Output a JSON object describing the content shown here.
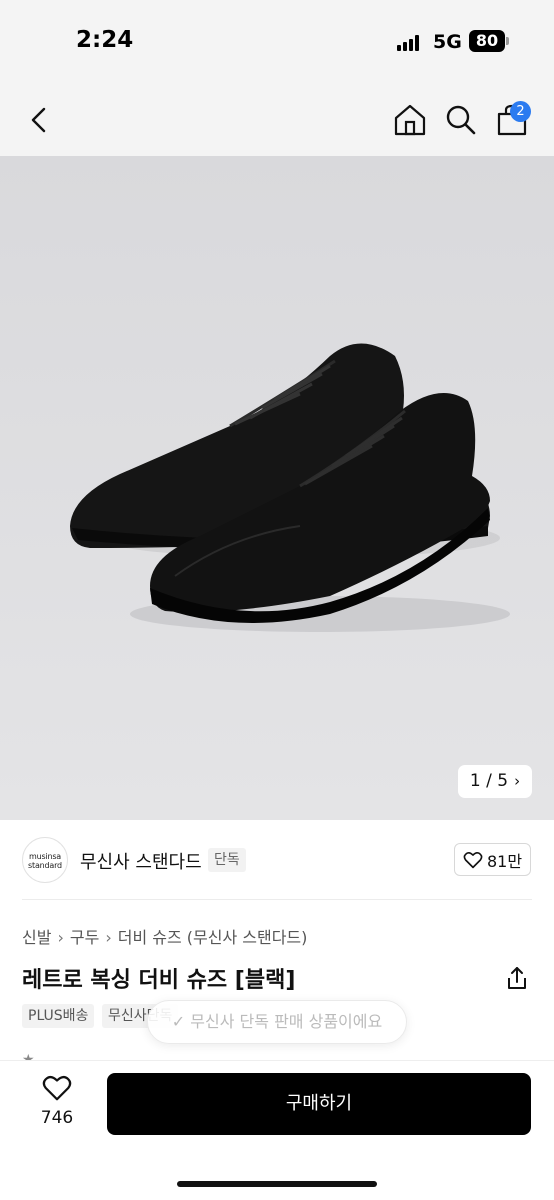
{
  "status": {
    "time": "2:24",
    "network": "5G",
    "battery": "80"
  },
  "nav": {
    "back_icon": "chevron-left-icon",
    "home_icon": "home-icon",
    "search_icon": "search-icon",
    "cart_icon": "shopping-bag-icon",
    "cart_badge": "2"
  },
  "gallery": {
    "current": "1",
    "total": "5",
    "indicator": "1 / 5"
  },
  "brand": {
    "logo_line1": "musinsa",
    "logo_line2": "standard",
    "name": "무신사 스탠다드",
    "tag": "단독",
    "likes": "81만"
  },
  "breadcrumb": {
    "items": [
      "신발",
      "구두",
      "더비 슈즈 (무신사 스탠다드)"
    ]
  },
  "product": {
    "title": "레트로 복싱 더비 슈즈 [블랙]",
    "tags": [
      "PLUS배송",
      "무신사단독"
    ]
  },
  "toast": {
    "text": "무신사 단독 판매 상품이에요"
  },
  "bottom": {
    "wish_count": "746",
    "buy_label": "구매하기"
  },
  "colors": {
    "accent_badge": "#2b7bf0",
    "buy_bg": "#000000"
  }
}
